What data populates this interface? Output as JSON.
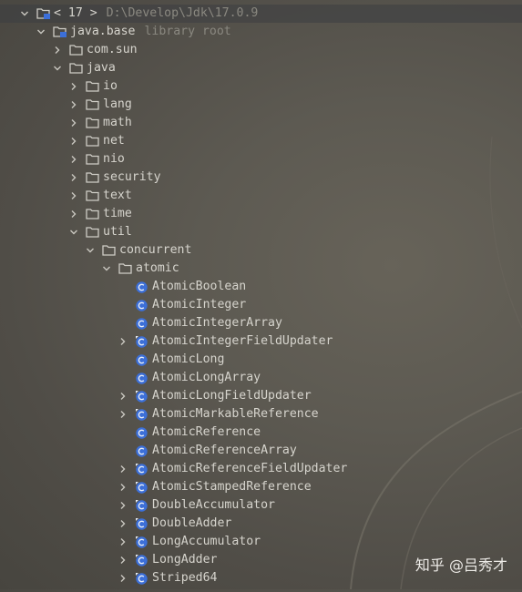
{
  "root": {
    "prefix": "< 17 >",
    "path": "D:\\Develop\\Jdk\\17.0.9"
  },
  "module": {
    "name": "java.base",
    "hint": "library root"
  },
  "packages_top": [
    "com.sun",
    "java"
  ],
  "java_children": [
    "io",
    "lang",
    "math",
    "net",
    "nio",
    "security",
    "text",
    "time",
    "util"
  ],
  "util_children": [
    "concurrent"
  ],
  "concurrent_children": [
    "atomic"
  ],
  "classes": [
    {
      "name": "AtomicBoolean",
      "expandable": false
    },
    {
      "name": "AtomicInteger",
      "expandable": false
    },
    {
      "name": "AtomicIntegerArray",
      "expandable": false
    },
    {
      "name": "AtomicIntegerFieldUpdater",
      "expandable": true
    },
    {
      "name": "AtomicLong",
      "expandable": false
    },
    {
      "name": "AtomicLongArray",
      "expandable": false
    },
    {
      "name": "AtomicLongFieldUpdater",
      "expandable": true
    },
    {
      "name": "AtomicMarkableReference",
      "expandable": true
    },
    {
      "name": "AtomicReference",
      "expandable": false
    },
    {
      "name": "AtomicReferenceArray",
      "expandable": false
    },
    {
      "name": "AtomicReferenceFieldUpdater",
      "expandable": true
    },
    {
      "name": "AtomicStampedReference",
      "expandable": true
    },
    {
      "name": "DoubleAccumulator",
      "expandable": true
    },
    {
      "name": "DoubleAdder",
      "expandable": true
    },
    {
      "name": "LongAccumulator",
      "expandable": true
    },
    {
      "name": "LongAdder",
      "expandable": true
    },
    {
      "name": "Striped64",
      "expandable": true
    }
  ],
  "watermark": "知乎 @吕秀才",
  "colors": {
    "class_icon": "#3c6fd8",
    "text": "#d6d4cd",
    "hint": "#8a8880"
  },
  "icons": {
    "folder": "folder-icon",
    "class": "class-icon",
    "library": "library-icon"
  }
}
